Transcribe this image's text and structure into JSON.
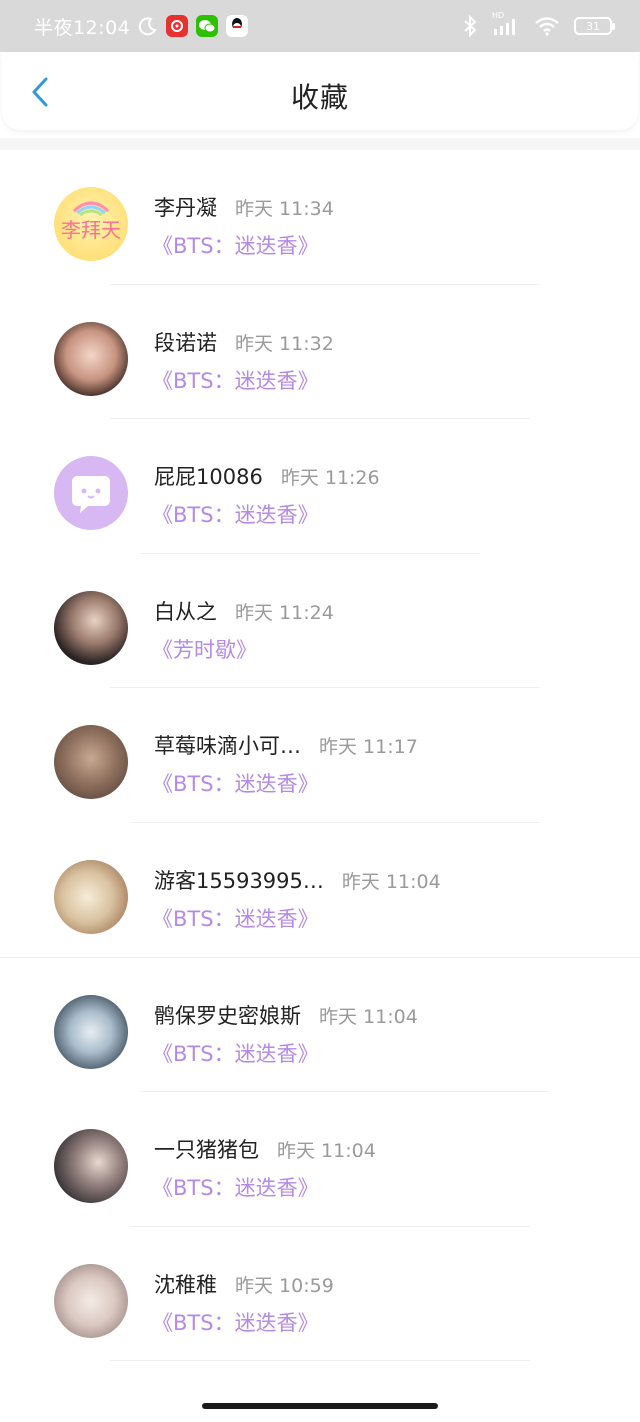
{
  "status_bar": {
    "time": "半夜12:04",
    "battery": "31",
    "network_badge": "HD",
    "icons": [
      "moon-icon",
      "netease-music-icon",
      "wechat-icon",
      "qq-icon",
      "bluetooth-icon",
      "signal-icon",
      "wifi-icon",
      "battery-icon"
    ]
  },
  "header": {
    "title": "收藏",
    "back_icon": "chevron-left-icon",
    "accent_color": "#2f9bd6"
  },
  "colors": {
    "title_link": "#b48ae6",
    "timestamp": "#9a9a9a",
    "name": "#222222"
  },
  "favorites": [
    {
      "name": "李丹凝",
      "time": "昨天 11:34",
      "title": "《BTS：迷迭香》",
      "avatar": "lemon"
    },
    {
      "name": "段诺诺",
      "time": "昨天 11:32",
      "title": "《BTS：迷迭香》",
      "avatar": "photo1"
    },
    {
      "name": "屁屁10086",
      "time": "昨天 11:26",
      "title": "《BTS：迷迭香》",
      "avatar": "purple"
    },
    {
      "name": "白从之",
      "time": "昨天 11:24",
      "title": "《芳时歇》",
      "avatar": "photo2"
    },
    {
      "name": "草莓味滴小可…",
      "time": "昨天 11:17",
      "title": "《BTS：迷迭香》",
      "avatar": "photo3"
    },
    {
      "name": "游客15593995…",
      "time": "昨天 11:04",
      "title": "《BTS：迷迭香》",
      "avatar": "photo4"
    },
    {
      "name": "鹘保罗史密娘斯",
      "time": "昨天 11:04",
      "title": "《BTS：迷迭香》",
      "avatar": "photo5"
    },
    {
      "name": "一只猪猪包",
      "time": "昨天 11:04",
      "title": "《BTS：迷迭香》",
      "avatar": "photo6"
    },
    {
      "name": "沈稚稚",
      "time": "昨天 10:59",
      "title": "《BTS：迷迭香》",
      "avatar": "photo7"
    }
  ]
}
